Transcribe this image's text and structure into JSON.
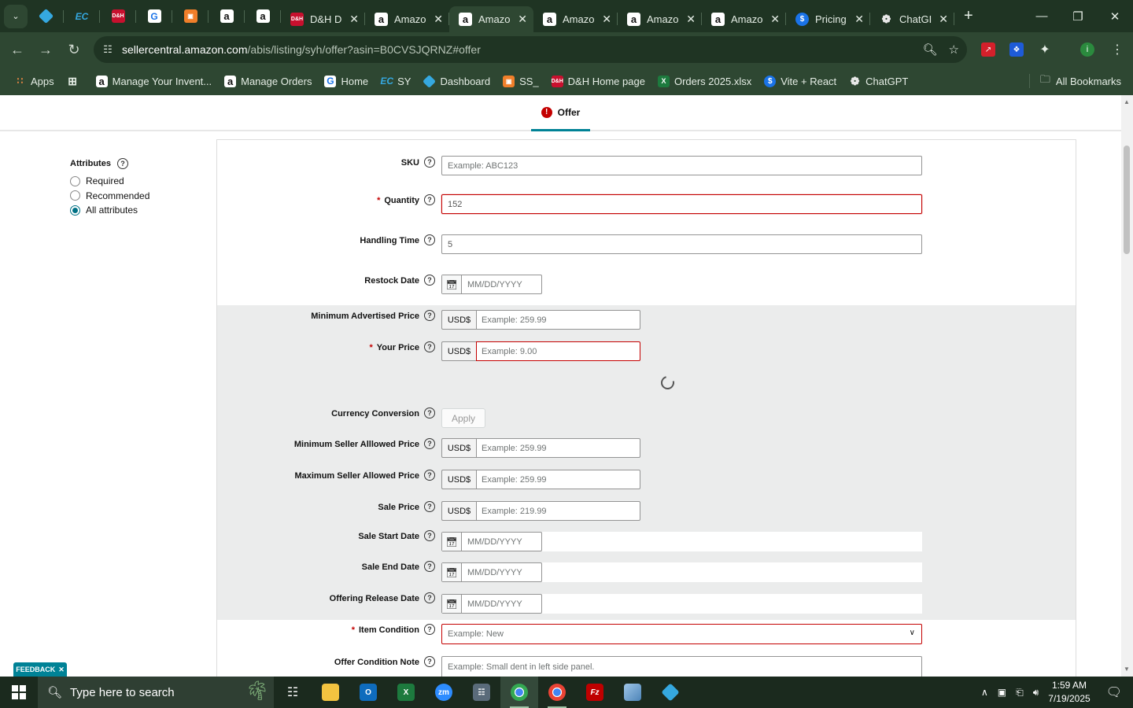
{
  "browser": {
    "tabs": [
      {
        "title": "D&H D",
        "favicon": "dh"
      },
      {
        "title": "Amazo",
        "favicon": "amazon"
      },
      {
        "title": "Amazo",
        "favicon": "amazon",
        "active": true
      },
      {
        "title": "Amazo",
        "favicon": "amazon"
      },
      {
        "title": "Amazo",
        "favicon": "amazon"
      },
      {
        "title": "Amazo",
        "favicon": "amazon"
      },
      {
        "title": "Pricing",
        "favicon": "dollar"
      },
      {
        "title": "ChatGI",
        "favicon": "chatgpt"
      }
    ],
    "url_host": "sellercentral.amazon.com",
    "url_path": "/abis/listing/syh/offer?asin=B0CVSJQRNZ#offer",
    "bookmarks": [
      {
        "label": "Apps",
        "icon": "apps-grid-icon"
      },
      {
        "label": "",
        "icon": "tab-groups-icon"
      },
      {
        "label": "Manage Your Invent...",
        "icon": "amazon-icon"
      },
      {
        "label": "Manage Orders",
        "icon": "amazon-icon"
      },
      {
        "label": "Home",
        "icon": "g-icon"
      },
      {
        "label": "SY",
        "icon": "ec-icon"
      },
      {
        "label": "Dashboard",
        "icon": "hex-icon"
      },
      {
        "label": "SS_",
        "icon": "box-icon"
      },
      {
        "label": "D&H Home page",
        "icon": "dh-icon"
      },
      {
        "label": "Orders 2025.xlsx",
        "icon": "excel-icon"
      },
      {
        "label": "Vite + React",
        "icon": "dollar-icon"
      },
      {
        "label": "ChatGPT",
        "icon": "chatgpt-icon"
      }
    ],
    "all_bookmarks": "All Bookmarks"
  },
  "page": {
    "offer_tab": "Offer",
    "attributes": {
      "title": "Attributes",
      "options": [
        "Required",
        "Recommended",
        "All attributes"
      ],
      "selected": "All attributes"
    },
    "fields": {
      "sku": {
        "label": "SKU",
        "placeholder": "Example: ABC123"
      },
      "quantity": {
        "label": "Quantity",
        "value": "152",
        "required": true
      },
      "handling_time": {
        "label": "Handling Time",
        "value": "5"
      },
      "restock_date": {
        "label": "Restock Date",
        "placeholder": "MM/DD/YYYY"
      },
      "min_advertised_price": {
        "label": "Minimum Advertised Price",
        "currency": "USD$",
        "placeholder": "Example: 259.99"
      },
      "your_price": {
        "label": "Your Price",
        "currency": "USD$",
        "placeholder": "Example: 9.00",
        "required": true
      },
      "currency_conversion": {
        "label": "Currency Conversion",
        "button": "Apply"
      },
      "min_seller_price": {
        "label": "Minimum Seller Alllowed Price",
        "currency": "USD$",
        "placeholder": "Example: 259.99"
      },
      "max_seller_price": {
        "label": "Maximum Seller Allowed Price",
        "currency": "USD$",
        "placeholder": "Example: 259.99"
      },
      "sale_price": {
        "label": "Sale Price",
        "currency": "USD$",
        "placeholder": "Example: 219.99"
      },
      "sale_start": {
        "label": "Sale Start Date",
        "placeholder": "MM/DD/YYYY"
      },
      "sale_end": {
        "label": "Sale End Date",
        "placeholder": "MM/DD/YYYY"
      },
      "release_date": {
        "label": "Offering Release Date",
        "placeholder": "MM/DD/YYYY"
      },
      "item_condition": {
        "label": "Item Condition",
        "placeholder": "Example: New",
        "required": true
      },
      "condition_note": {
        "label": "Offer Condition Note",
        "placeholder": "Example: Small dent in left side panel."
      }
    },
    "feedback": "FEEDBACK"
  },
  "taskbar": {
    "search_placeholder": "Type here to search",
    "time": "1:59 AM",
    "date": "7/19/2025"
  }
}
